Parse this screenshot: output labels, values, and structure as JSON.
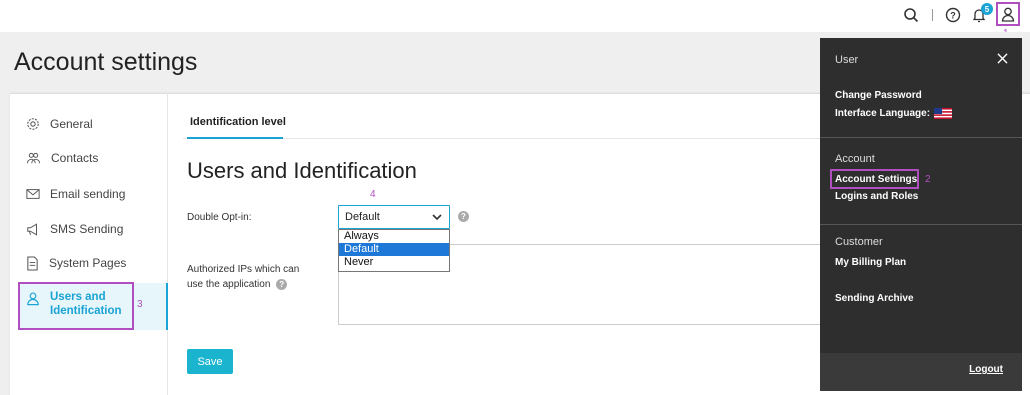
{
  "topbar": {
    "notification_count": "5",
    "anno_user": "1"
  },
  "page": {
    "title": "Account settings"
  },
  "sidebar": {
    "items": [
      {
        "label": "General",
        "icon": "gear-icon"
      },
      {
        "label": "Contacts",
        "icon": "contacts-icon"
      },
      {
        "label": "Email sending",
        "icon": "envelope-icon"
      },
      {
        "label": "SMS Sending",
        "icon": "megaphone-icon"
      },
      {
        "label": "System Pages",
        "icon": "page-icon"
      },
      {
        "label": "Users and\nIdentification",
        "icon": "user-icon",
        "active": true
      }
    ],
    "anno": "3"
  },
  "main": {
    "tab": "Identification level",
    "section_title": "Users and Identification",
    "anno_select": "4",
    "double_optin": {
      "label": "Double Opt-in:",
      "value": "Default",
      "options": [
        "Always",
        "Default",
        "Never"
      ]
    },
    "authorized_ips": {
      "label": "Authorized IPs which can use the application",
      "value": ""
    },
    "save_label": "Save"
  },
  "user_panel": {
    "user_heading": "User",
    "change_password": "Change Password",
    "interface_language": "Interface Language:",
    "account_heading": "Account",
    "account_settings": "Account Settings",
    "anno_account": "2",
    "logins_roles": "Logins and Roles",
    "customer_heading": "Customer",
    "billing_plan": "My Billing Plan",
    "sending_archive": "Sending Archive",
    "logout": "Logout"
  },
  "colors": {
    "accent": "#1aa3d4",
    "annotation": "#b04fc0",
    "panel_bg": "#2e2e2e"
  }
}
